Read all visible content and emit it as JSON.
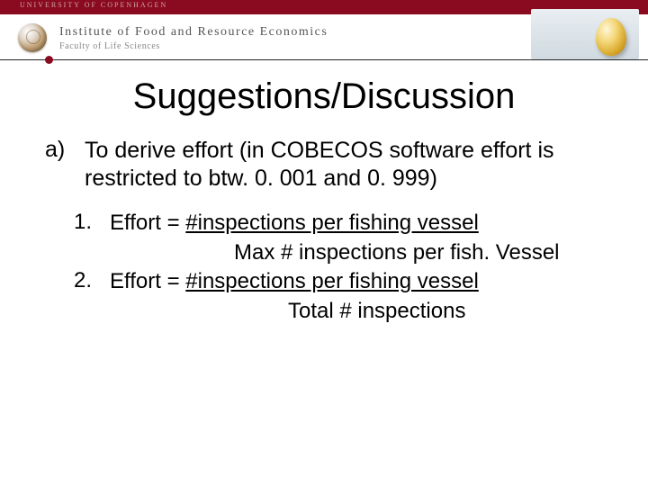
{
  "header": {
    "university": "UNIVERSITY OF COPENHAGEN",
    "institute": "Institute of Food and Resource Economics",
    "faculty": "Faculty of Life Sciences"
  },
  "title": "Suggestions/Discussion",
  "list": {
    "a": {
      "marker": "a)",
      "text": "To derive effort (in COBECOS software effort is restricted to btw. 0. 001 and 0. 999)"
    },
    "sub": {
      "one": {
        "marker": "1.",
        "lead": "Effort = ",
        "underlined": "#inspections per fishing vessel",
        "line2": "Max # inspections per fish. Vessel"
      },
      "two": {
        "marker": "2.",
        "lead": "Effort = ",
        "underlined": "#inspections per fishing vessel",
        "line2": "Total # inspections"
      }
    }
  }
}
